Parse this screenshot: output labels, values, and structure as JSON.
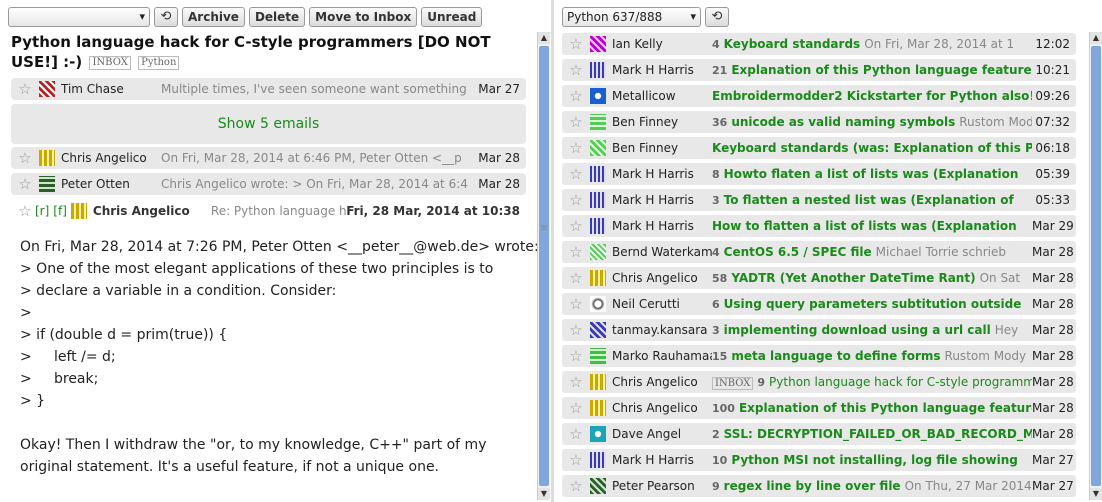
{
  "left": {
    "folder_select_value": "",
    "buttons": {
      "archive": "Archive",
      "delete": "Delete",
      "move_to_inbox": "Move to Inbox",
      "unread": "Unread"
    },
    "thread_title": "Python language hack for C-style programmers [DO NOT USE!] :-)",
    "tags": [
      "INBOX",
      "Python"
    ],
    "messages": [
      {
        "from": "Tim Chase",
        "snippet": "Multiple times, I've seen someone want something",
        "date": "Mar 27"
      },
      {
        "from": "Chris Angelico",
        "snippet": "On Fri, Mar 28, 2014 at 6:46 PM, Peter Otten <__p",
        "date": "Mar 28"
      },
      {
        "from": "Peter Otten",
        "snippet": "Chris Angelico wrote: > On Fri, Mar 28, 2014 at 6:4",
        "date": "Mar 28"
      }
    ],
    "show_more": "Show 5 emails",
    "open_message": {
      "reply": "[r]",
      "forward": "[f]",
      "from": "Chris Angelico",
      "snippet": "Re: Python language ha",
      "date": "Fri, 28 Mar, 2014 at 10:38",
      "body": "On Fri, Mar 28, 2014 at 7:26 PM, Peter Otten <__peter__@web.de> wrote:\n> One of the most elegant applications of these two principles is to\n> declare a variable in a condition. Consider:\n>\n> if (double d = prim(true)) {\n>     left /= d;\n>     break;\n> }\n\nOkay! Then I withdraw the \"or, to my knowledge, C++\" part of my\noriginal statement. It's a useful feature, if not a unique one."
    }
  },
  "right": {
    "folder_select_value": "Python 637/888",
    "rows": [
      {
        "from": "Ian Kelly",
        "count": "4",
        "subject": "Keyboard standards",
        "preview": "On Fri, Mar 28, 2014 at 1",
        "time": "12:02",
        "subject_color": "#1a8a1a"
      },
      {
        "from": "Mark H Harris",
        "count": "21",
        "subject": "Explanation of this Python language feature",
        "preview": "",
        "time": "10:21"
      },
      {
        "from": "Metallicow",
        "count": "",
        "subject": "Embroidermodder2 Kickstarter for Python also!",
        "preview": "",
        "time": "09:26"
      },
      {
        "from": "Ben Finney",
        "count": "36",
        "subject": "unicode as valid naming symbols",
        "preview": "Rustom Mody",
        "time": "07:32"
      },
      {
        "from": "Ben Finney",
        "count": "",
        "subject": "Keyboard standards (was: Explanation of this Python",
        "preview": "",
        "time": "06:18"
      },
      {
        "from": "Mark H Harris",
        "count": "8",
        "subject": "Howto flaten a list of lists was (Explanation",
        "preview": "",
        "time": "05:39"
      },
      {
        "from": "Mark H Harris",
        "count": "3",
        "subject": "To flatten a nested list was (Explanation of",
        "preview": "",
        "time": "05:33"
      },
      {
        "from": "Mark H Harris",
        "count": "",
        "subject": "How to flatten a list of lists was (Explanation",
        "preview": "",
        "time": "Mar 29"
      },
      {
        "from": "Bernd Waterkamp",
        "count": "4",
        "subject": "CentOS 6.5 / SPEC file",
        "preview": "Michael Torrie schrieb",
        "time": "Mar 28"
      },
      {
        "from": "Chris Angelico",
        "count": "58",
        "subject": "YADTR (Yet Another DateTime Rant)",
        "preview": "On Sat",
        "time": "Mar 28"
      },
      {
        "from": "Neil Cerutti",
        "count": "6",
        "subject": "Using query parameters subtitution outside",
        "preview": "",
        "time": "Mar 28"
      },
      {
        "from": "tanmay.kansara",
        "count": "3",
        "subject": "implementing download using a url call",
        "preview": "Hey",
        "time": "Mar 28"
      },
      {
        "from": "Marko Rauhamaa",
        "count": "15",
        "subject": "meta language to define forms",
        "preview": "Rustom Mody",
        "time": "Mar 28"
      },
      {
        "from": "Chris Angelico",
        "count": "9",
        "subject": "Python language hack for C-style programmers",
        "preview": "",
        "time": "Mar 28",
        "inbox": "INBOX",
        "normal": true
      },
      {
        "from": "Chris Angelico",
        "count": "100",
        "subject": "Explanation of this Python language feature",
        "preview": "",
        "time": "Mar 28"
      },
      {
        "from": "Dave Angel",
        "count": "2",
        "subject": "SSL: DECRYPTION_FAILED_OR_BAD_RECORD_MAC",
        "preview": "",
        "time": "Mar 28"
      },
      {
        "from": "Mark H Harris",
        "count": "10",
        "subject": "Python MSI not installing, log file showing",
        "preview": "",
        "time": "Mar 27"
      },
      {
        "from": "Peter Pearson",
        "count": "9",
        "subject": "regex line by line over file",
        "preview": "On Thu, 27 Mar 2014",
        "time": "Mar 27"
      }
    ]
  },
  "colors": {
    "accent_green": "#1a8a1a",
    "row_bg": "#e8e8e8",
    "scroll_thumb": "#7fa7dc"
  }
}
